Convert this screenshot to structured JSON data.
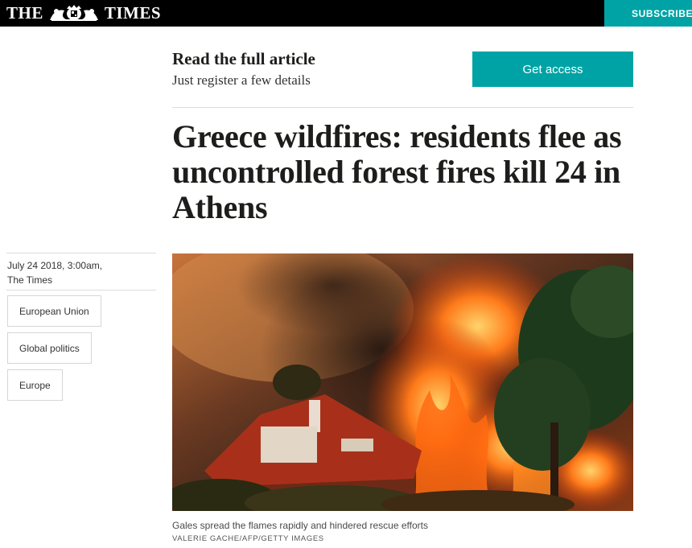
{
  "header": {
    "masthead_left": "THE",
    "masthead_right": "TIMES",
    "subscribe_label": "SUBSCRIBE"
  },
  "paywall": {
    "title": "Read the full article",
    "subtitle": "Just register a few details",
    "button_label": "Get access"
  },
  "article": {
    "headline": "Greece wildfires: residents flee as uncontrolled forest fires kill 24 in Athens",
    "date": "July 24 2018, 3:00am,",
    "source": "The Times",
    "tags": [
      "European Union",
      "Global politics",
      "Europe"
    ],
    "image": {
      "caption": "Gales spread the flames rapidly and hindered rescue efforts",
      "credit": "VALERIE GACHE/AFP/GETTY IMAGES"
    }
  },
  "colors": {
    "accent": "#00a3a5",
    "topbar": "#000000"
  }
}
